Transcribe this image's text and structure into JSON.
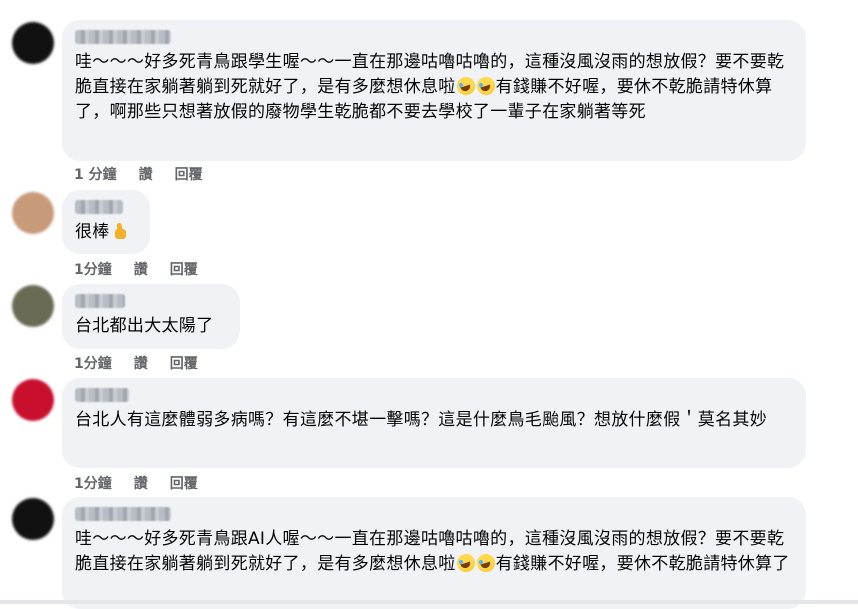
{
  "comments": [
    {
      "text_a": "哇～～～好多死青鳥跟學生喔～～一直在那邊咕嚕咕嚕的，這種沒風沒雨的想放假？要不要乾脆直接在家躺著躺到死就好了，是有多麼想休息啦",
      "text_b": "有錢賺不好喔，要休不乾脆請特休算了，啊那些只想著放假的廢物學生乾脆都不要去學校了一輩子在家躺著等死",
      "time": "1 分鐘",
      "like": "讚",
      "reply": "回覆",
      "avatar_color": "#111111"
    },
    {
      "text_a": "很棒",
      "time": "1分鐘",
      "like": "讚",
      "reply": "回覆",
      "avatar_color": "#c79a7a"
    },
    {
      "text_a": "台北都出大太陽了",
      "time": "1分鐘",
      "like": "讚",
      "reply": "回覆",
      "avatar_color": "#6b6a55"
    },
    {
      "text_a": "台北人有這麼體弱多病嗎？有這麼不堪一擊嗎？這是什麼鳥毛颱風？想放什麼假＇莫名其妙",
      "time": "1分鐘",
      "like": "讚",
      "reply": "回覆",
      "avatar_color": "#c8102e"
    },
    {
      "text_a": "哇～～～好多死青鳥跟AI人喔～～一直在那邊咕嚕咕嚕的，這種沒風沒雨的想放假？要不要乾脆直接在家躺著躺到死就好了，是有多麼想休息啦",
      "text_b": "有錢賺不好喔，要休不乾脆請特休算了",
      "avatar_color": "#111111"
    }
  ],
  "icons": {
    "laugh": "rolling-on-floor-laughing-emoji",
    "thumb": "thumbs-up-emoji"
  }
}
